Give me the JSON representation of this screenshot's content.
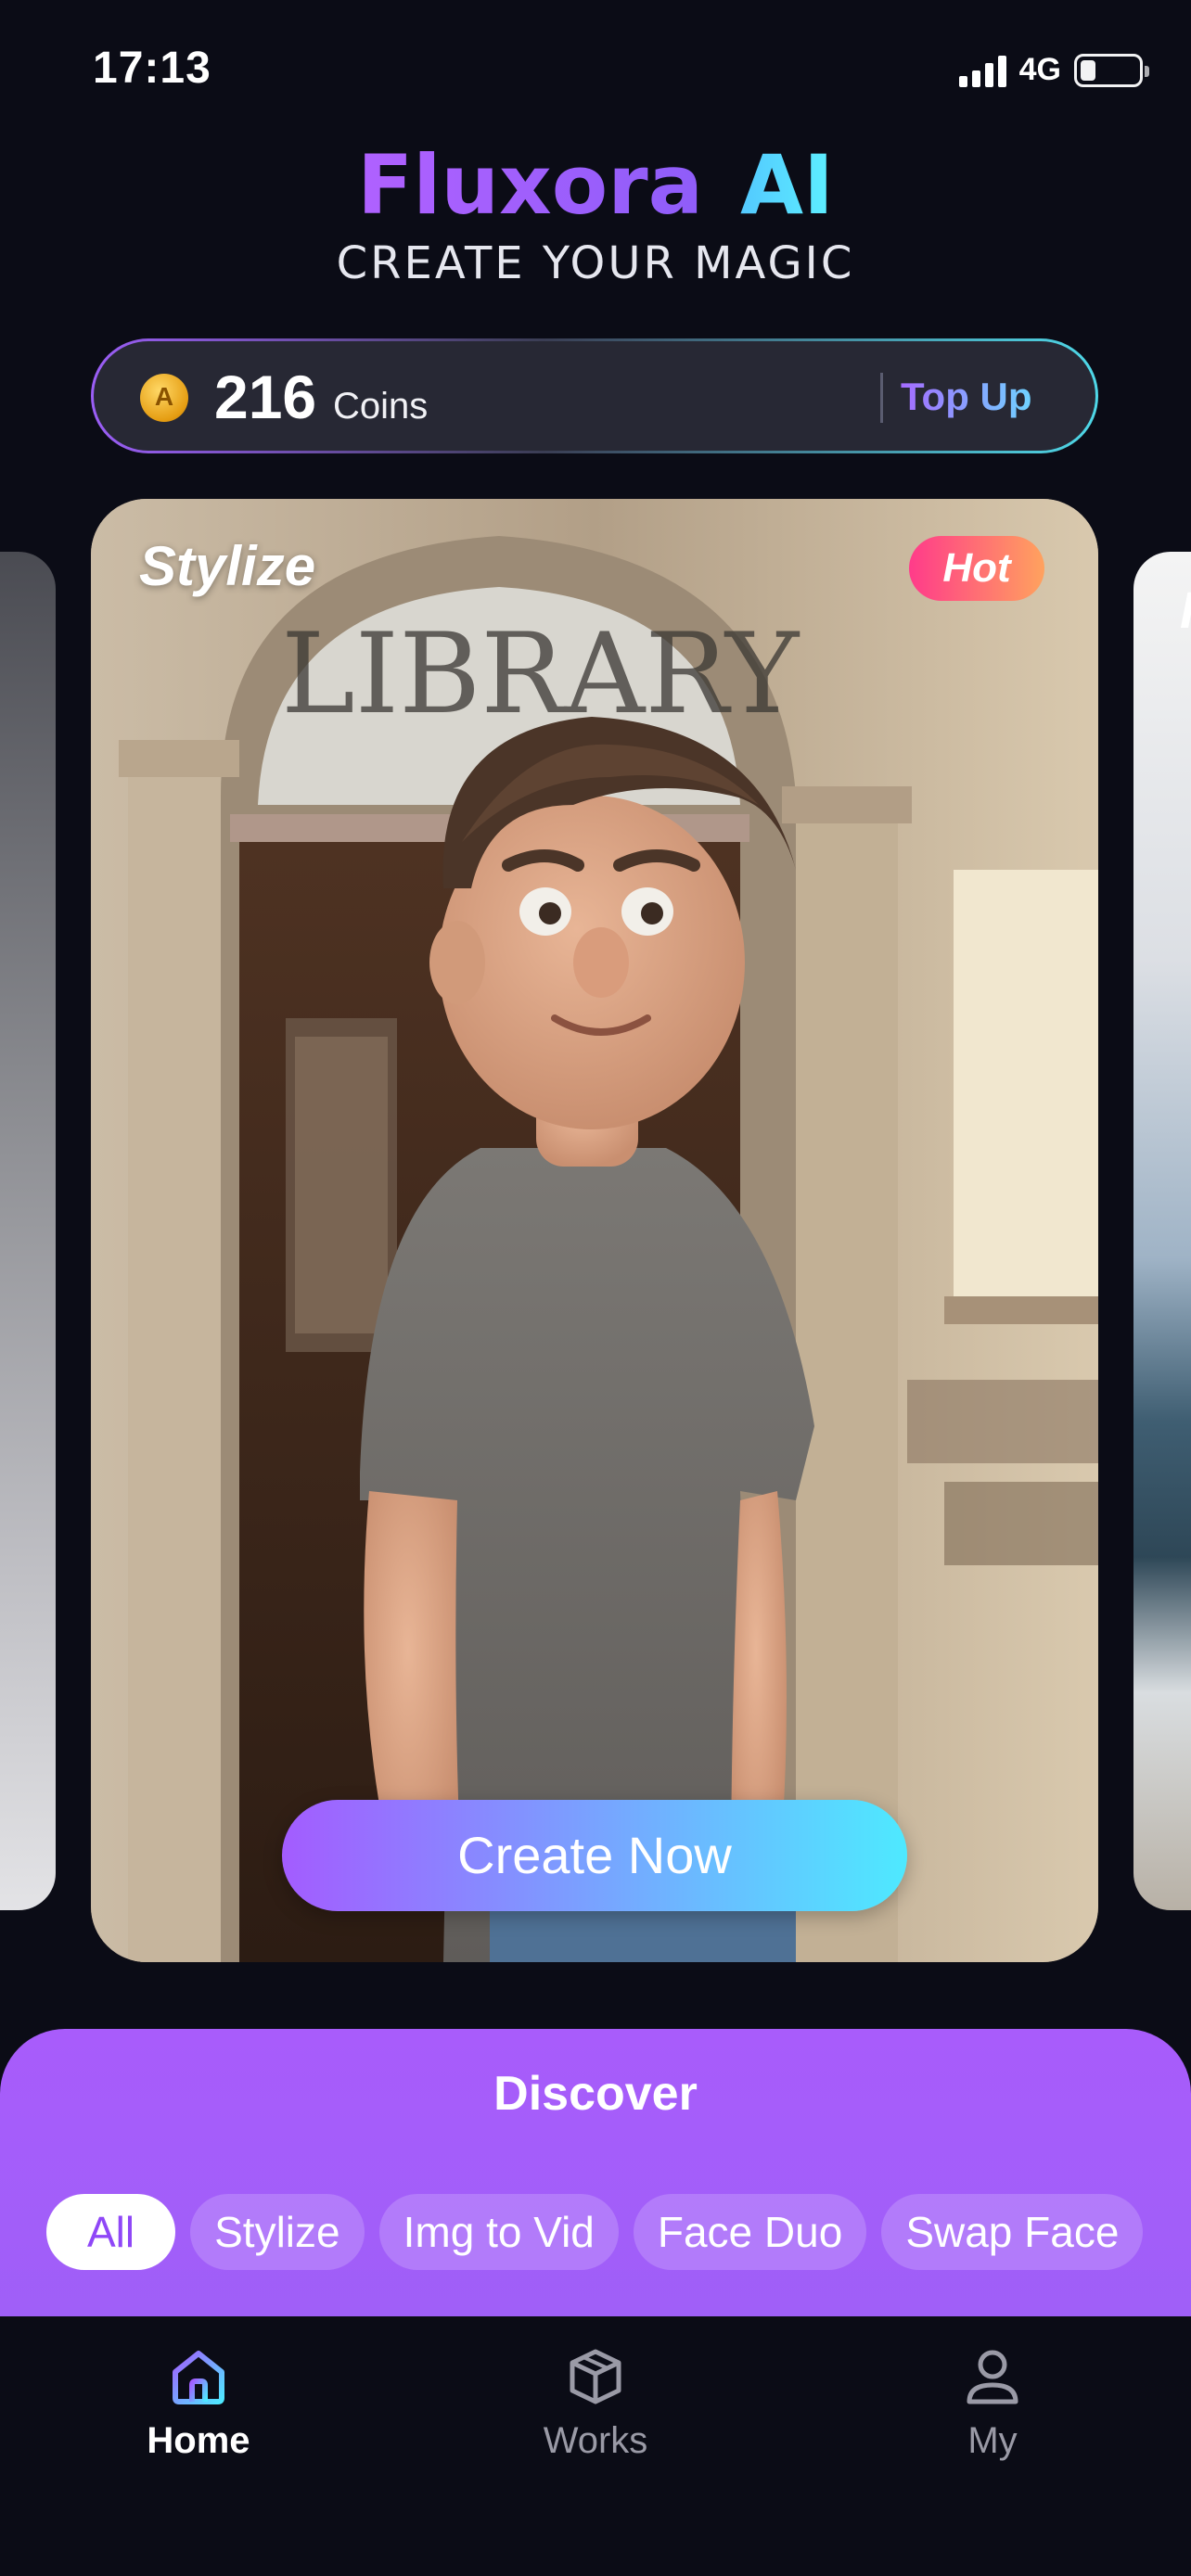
{
  "status_bar": {
    "time": "17:13",
    "network": "4G"
  },
  "header": {
    "title_part1": "Fluxora",
    "title_part2": "AI",
    "subtitle": "CREATE YOUR MAGIC"
  },
  "coins": {
    "count": "216",
    "label": "Coins",
    "coin_symbol": "A",
    "topup_label": "Top Up"
  },
  "carousel": {
    "current": {
      "label": "Stylize",
      "badge": "Hot",
      "cta": "Create Now"
    },
    "next_label_partial": "F"
  },
  "discover": {
    "title": "Discover",
    "chips": [
      "All",
      "Stylize",
      "Img to Vid",
      "Face Duo",
      "Swap Face"
    ],
    "active_chip": "All"
  },
  "tabs": [
    {
      "label": "Home",
      "icon": "home-icon",
      "active": true
    },
    {
      "label": "Works",
      "icon": "cube-icon",
      "active": false
    },
    {
      "label": "My",
      "icon": "person-icon",
      "active": false
    }
  ],
  "colors": {
    "background": "#0b0c16",
    "accent_purple": "#a35cff",
    "accent_cyan": "#4ee9ff",
    "hot_badge_start": "#ff3b8a",
    "hot_badge_end": "#ffa25e"
  }
}
